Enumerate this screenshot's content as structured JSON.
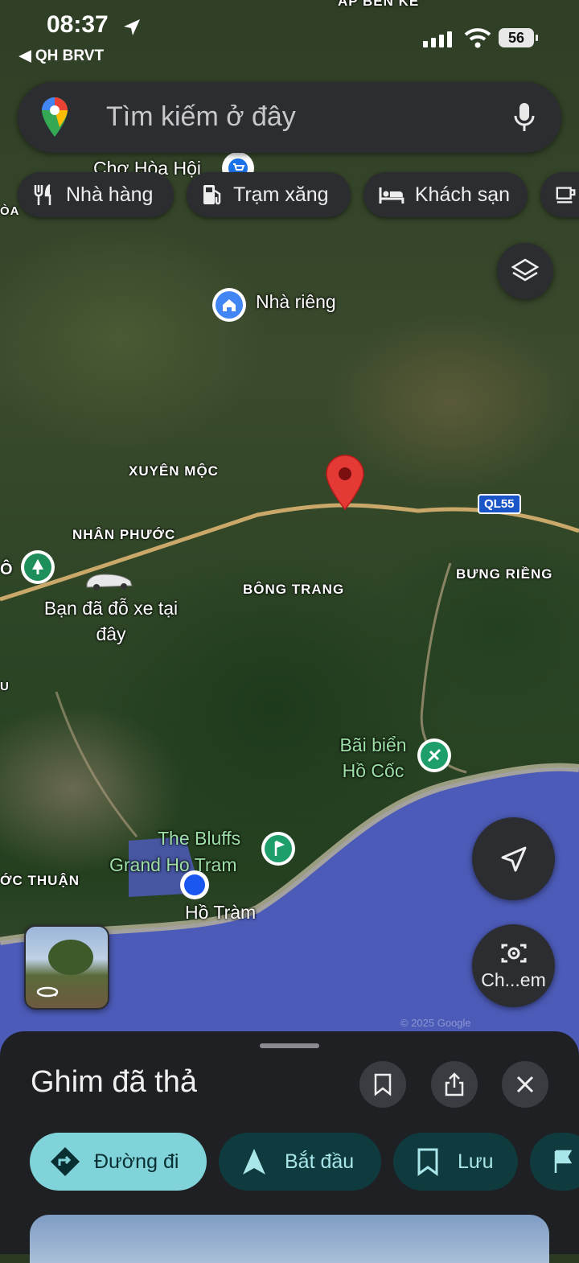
{
  "status_bar": {
    "time": "08:37",
    "back_app": "QH BRVT",
    "battery": "56",
    "icons": [
      "location-arrow-icon",
      "signal-icon",
      "wifi-icon",
      "battery-icon"
    ]
  },
  "search": {
    "placeholder": "Tìm kiếm ở đây",
    "icons": [
      "google-maps-pin-icon",
      "microphone-icon"
    ]
  },
  "chips": [
    {
      "label": "Nhà hàng",
      "icon": "restaurant-icon"
    },
    {
      "label": "Trạm xăng",
      "icon": "gas-station-icon"
    },
    {
      "label": "Khách sạn",
      "icon": "hotel-icon"
    }
  ],
  "map": {
    "top_partial_label": "ẤP BẾN KẾ",
    "places": {
      "market": "Chợ Hòa Hội",
      "home": "Nhà riêng",
      "xuyen_moc": "XUYÊN MỘC",
      "nhan_phuoc": "NHÂN PHƯỚC",
      "bong_trang": "BÔNG TRANG",
      "bung_rieng": "BƯNG RIỀNG",
      "highway": "QL55",
      "parked": "Bạn đã đỗ xe tại đây",
      "ho_coc": "Bãi biển Hồ Cốc",
      "bluffs_1": "The Bluffs",
      "bluffs_2": "Grand Ho Tram",
      "ho_tram": "Hồ Tràm",
      "phuoc_thuan": "ỚC THUẬN",
      "edge_o": "Ô",
      "edge_u": "U",
      "edge_hoa": "ÒA",
      "watermark": "© 2025 Google"
    },
    "accent_colors": {
      "pin": "#e53935",
      "you": "#1a56f0",
      "park": "#1e8e5a",
      "home": "#4285f4"
    }
  },
  "floating": {
    "layers_icon": "layers-icon",
    "locate_icon": "navigation-arrow-icon",
    "camera_label": "Ch...em",
    "camera_icon": "camera-search-icon"
  },
  "sheet": {
    "title": "Ghim đã thả",
    "icons": [
      "bookmark-icon",
      "share-icon",
      "close-icon"
    ],
    "actions": [
      {
        "label": "Đường đi",
        "icon": "directions-icon"
      },
      {
        "label": "Bắt đầu",
        "icon": "navigation-start-icon"
      },
      {
        "label": "Lưu",
        "icon": "bookmark-icon"
      }
    ]
  }
}
